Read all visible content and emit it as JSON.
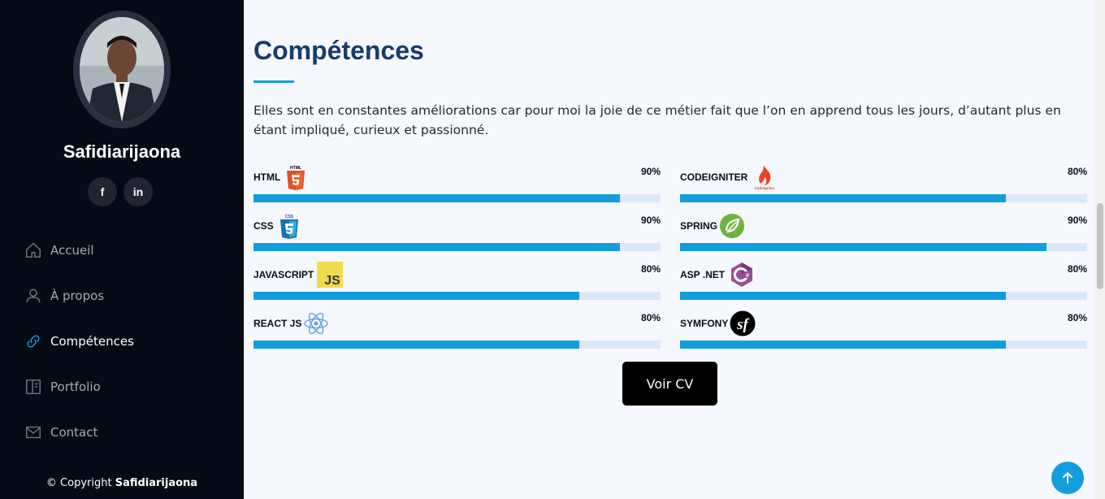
{
  "sidebar": {
    "name": "Safidiarijaona",
    "social": [
      {
        "icon": "facebook-icon",
        "label": "f"
      },
      {
        "icon": "linkedin-icon",
        "label": "in"
      }
    ],
    "nav": [
      {
        "label": "Accueil",
        "icon": "home-icon",
        "active": false
      },
      {
        "label": "À propos",
        "icon": "user-icon",
        "active": false
      },
      {
        "label": "Compétences",
        "icon": "link-icon",
        "active": true
      },
      {
        "label": "Portfolio",
        "icon": "portfolio-icon",
        "active": false
      },
      {
        "label": "Contact",
        "icon": "mail-icon",
        "active": false
      }
    ],
    "copyright_prefix": "© Copyright",
    "copyright_name": "Safidiarijaona"
  },
  "main": {
    "title": "Compétences",
    "intro": "Elles sont en constantes améliorations car pour moi la joie de ce métier fait que l’on en apprend tous les jours, d’autant plus en étant impliqué, curieux et passionné.",
    "skills_left": [
      {
        "label": "HTML",
        "percent_text": "90%",
        "value": 0.9,
        "logo": "html5-icon"
      },
      {
        "label": "CSS",
        "percent_text": "90%",
        "value": 0.9,
        "logo": "css3-icon"
      },
      {
        "label": "JAVASCRIPT",
        "percent_text": "80%",
        "value": 0.8,
        "logo": "javascript-icon"
      },
      {
        "label": "REACT JS",
        "percent_text": "80%",
        "value": 0.8,
        "logo": "react-icon"
      }
    ],
    "skills_right": [
      {
        "label": "CODEIGNITER",
        "percent_text": "80%",
        "value": 0.8,
        "logo": "codeigniter-icon"
      },
      {
        "label": "SPRING",
        "percent_text": "90%",
        "value": 0.9,
        "logo": "spring-icon"
      },
      {
        "label": "ASP .NET",
        "percent_text": "80%",
        "value": 0.8,
        "logo": "csharp-icon"
      },
      {
        "label": "SYMFONY",
        "percent_text": "80%",
        "value": 0.8,
        "logo": "symfony-icon"
      }
    ],
    "cv_button": "Voir CV",
    "logo_texts": {
      "html": "HTML",
      "css": "CSS",
      "js": "JS",
      "codeigniter": "CodeIgniter"
    }
  },
  "colors": {
    "accent": "#149ddd",
    "sidebar_bg": "#040b14",
    "title": "#173b6c",
    "bar_bg": "#dce8f8"
  }
}
